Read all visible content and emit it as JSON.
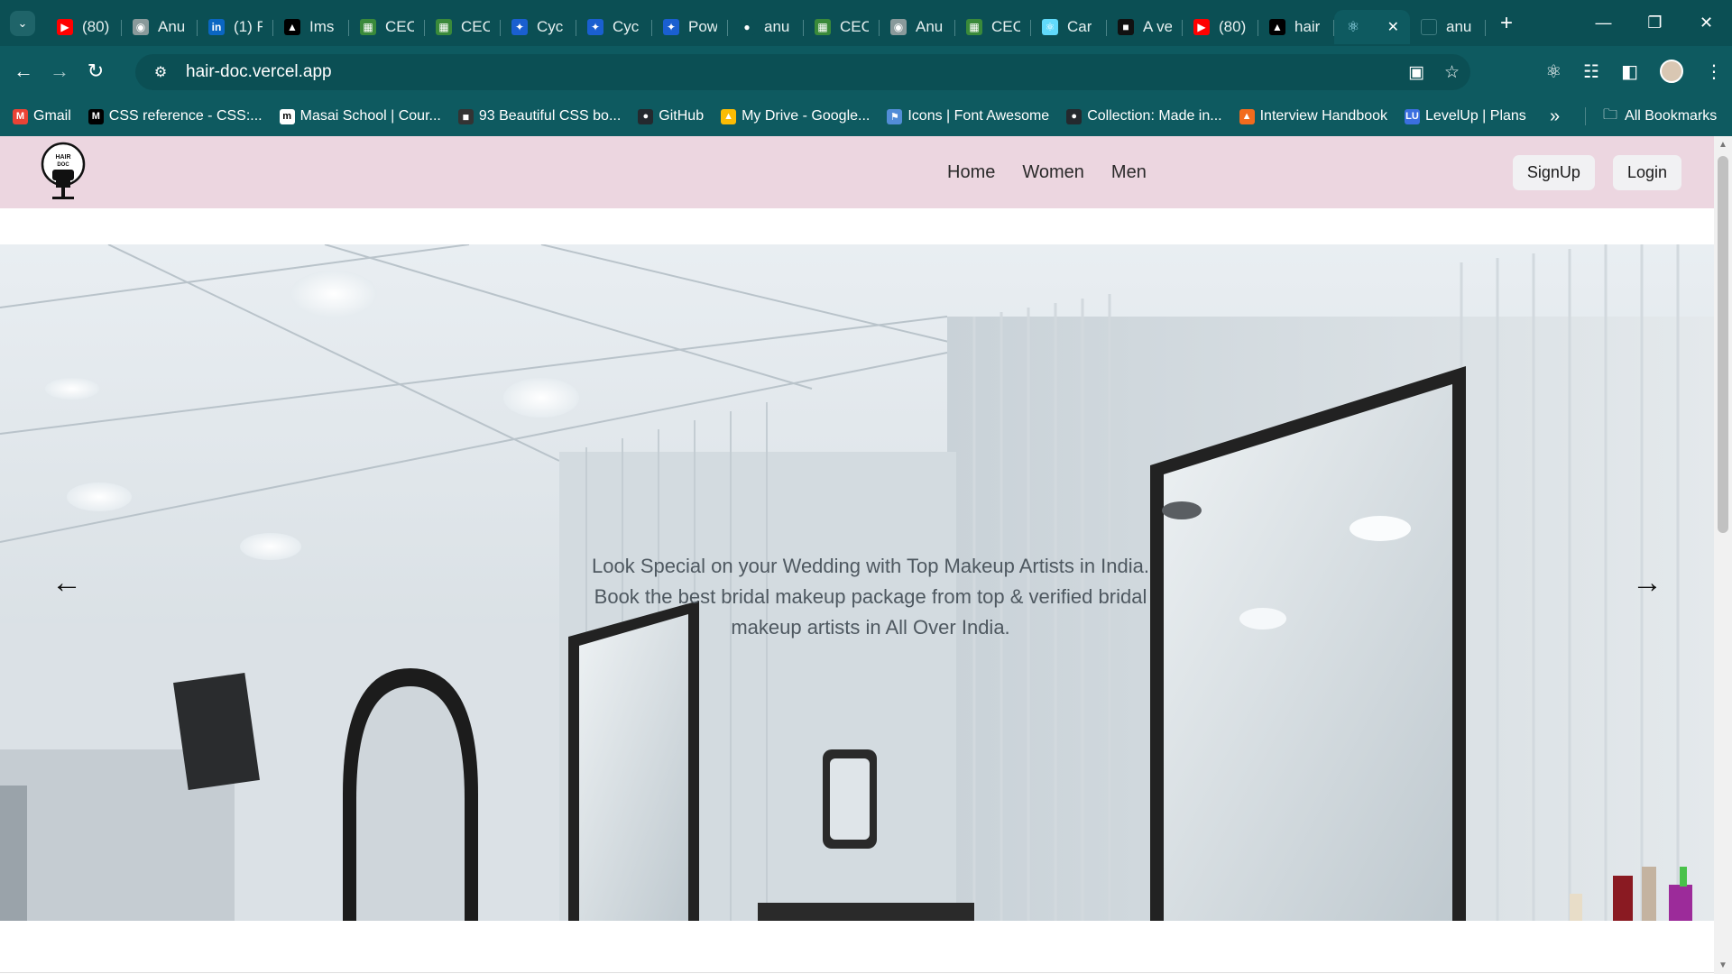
{
  "browser": {
    "tabs": [
      {
        "title": "(80)",
        "icon": "youtube-icon",
        "color": "#ff0000"
      },
      {
        "title": "Anu",
        "icon": "globe-icon",
        "color": "#8a9a9b"
      },
      {
        "title": "(1) F",
        "icon": "linkedin-icon",
        "color": "#0a66c2"
      },
      {
        "title": "Ims",
        "icon": "vercel-icon",
        "color": "#000000"
      },
      {
        "title": "CEC",
        "icon": "doc-icon",
        "color": "#3a8a3a"
      },
      {
        "title": "CEC",
        "icon": "doc-icon",
        "color": "#3a8a3a"
      },
      {
        "title": "Cyc",
        "icon": "bolt-icon",
        "color": "#1a5fd0"
      },
      {
        "title": "Cyc",
        "icon": "bolt-icon",
        "color": "#1a5fd0"
      },
      {
        "title": "Pow",
        "icon": "bolt-icon",
        "color": "#1a5fd0"
      },
      {
        "title": "anu",
        "icon": "github-icon",
        "color": "#0b4f54"
      },
      {
        "title": "CEC",
        "icon": "doc-icon",
        "color": "#3a8a3a"
      },
      {
        "title": "Anu",
        "icon": "globe-icon",
        "color": "#8a9a9b"
      },
      {
        "title": "CEC",
        "icon": "doc-icon",
        "color": "#3a8a3a"
      },
      {
        "title": "Car",
        "icon": "react-icon",
        "color": "#61dafb"
      },
      {
        "title": "A ve",
        "icon": "cube-icon",
        "color": "#111111"
      },
      {
        "title": "(80)",
        "icon": "youtube-icon",
        "color": "#ff0000"
      },
      {
        "title": "hair",
        "icon": "vercel-icon",
        "color": "#000000"
      }
    ],
    "active_tab": {
      "title": "",
      "icon": "react-icon"
    },
    "after_tab": {
      "title": "anu",
      "icon": "github-icon"
    },
    "url": "hair-doc.vercel.app",
    "bookmarks": [
      {
        "label": "Gmail",
        "icon": "gmail-icon",
        "color": "#ea4335"
      },
      {
        "label": "CSS reference - CSS:...",
        "icon": "mdn-icon",
        "color": "#000000"
      },
      {
        "label": "Masai School | Cour...",
        "icon": "masai-icon",
        "color": "#ffffff"
      },
      {
        "label": "93 Beautiful CSS bo...",
        "icon": "cssbox-icon",
        "color": "#333333"
      },
      {
        "label": "GitHub",
        "icon": "github-icon",
        "color": "#24292e"
      },
      {
        "label": "My Drive - Google...",
        "icon": "drive-icon",
        "color": "#fbbc04"
      },
      {
        "label": "Icons | Font Awesome",
        "icon": "flag-icon",
        "color": "#528dd7"
      },
      {
        "label": "Collection: Made in...",
        "icon": "github-icon",
        "color": "#24292e"
      },
      {
        "label": "Interview Handbook",
        "icon": "handbook-icon",
        "color": "#f26b1d"
      },
      {
        "label": "LevelUp | Plans",
        "icon": "levelup-icon",
        "color": "#3b6fe0"
      }
    ],
    "all_bookmarks": "All Bookmarks"
  },
  "site": {
    "nav": [
      "Home",
      "Women",
      "Men"
    ],
    "signup": "SignUp",
    "login": "Login",
    "logo_text": [
      "HAIR",
      "DOC"
    ],
    "hero_text": "Look Special on your Wedding with Top Makeup Artists in India. Book the best bridal makeup package from top & verified bridal makeup artists in All Over India.",
    "colors": {
      "header_bg": "#ecd6e0",
      "chrome": "#0e5a60"
    }
  }
}
